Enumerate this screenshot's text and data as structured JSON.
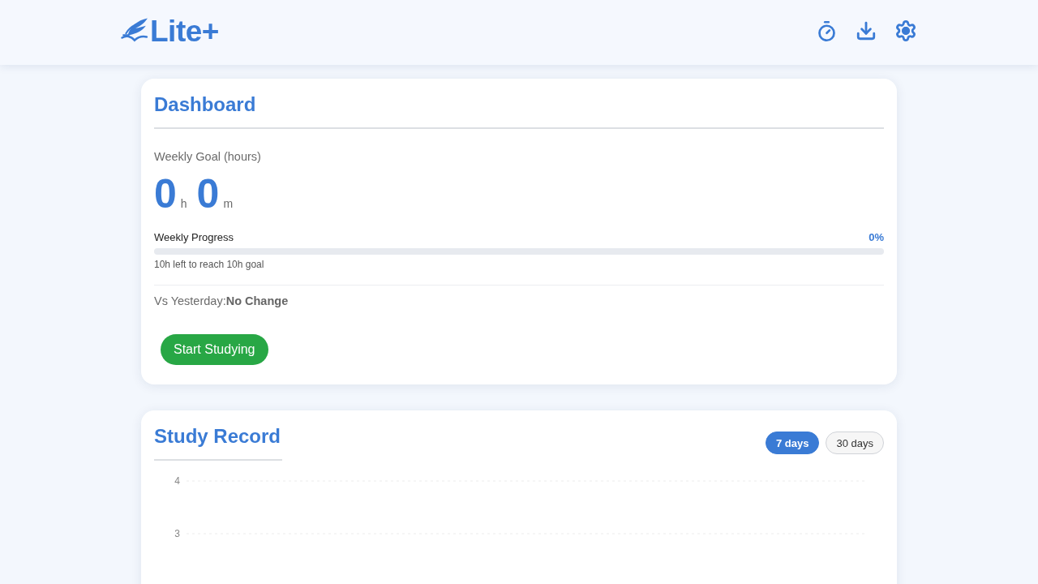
{
  "header": {
    "logo": "Lite+"
  },
  "dashboard": {
    "title": "Dashboard",
    "goal_label": "Weekly Goal (hours)",
    "hours": "0",
    "hours_unit": "h",
    "minutes": "0",
    "minutes_unit": "m",
    "progress": {
      "label": "Weekly Progress",
      "percent": "0%",
      "level": 0,
      "remaining": "10h left to reach 10h goal"
    },
    "comparison": "Vs Yesterday:**No Change**",
    "start_button": "Start Studying"
  },
  "study_record": {
    "title": "Study Record",
    "ranges": [
      {
        "label": "7 days",
        "selected": true
      },
      {
        "label": "30 days",
        "selected": false
      }
    ],
    "chart_axis_labels": [
      "4",
      "3"
    ]
  }
}
